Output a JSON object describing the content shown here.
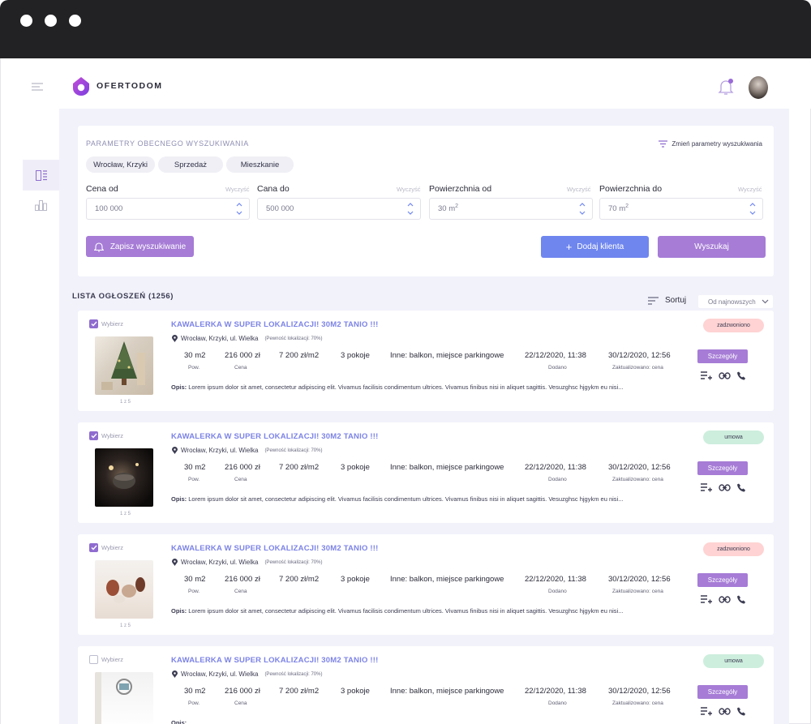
{
  "app": {
    "logo_text": "OFERTODOM"
  },
  "search_params": {
    "title": "PARAMETRY OBECNEGO WYSZUKIWANIA",
    "change_label": "Zmień parametry wyszukiwania",
    "chips": [
      "Wrocław, Krzyki",
      "Sprzedaż",
      "Mieszkanie"
    ],
    "fields": [
      {
        "label": "Cena od",
        "clear": "Wyczyść",
        "value": "100 000"
      },
      {
        "label": "Cana do",
        "clear": "Wyczyść",
        "value": "500 000"
      },
      {
        "label": "Powierzchnia od",
        "clear": "Wyczyść",
        "value": "30 m",
        "sup": "2"
      },
      {
        "label": "Powierzchnia do",
        "clear": "Wyczyść",
        "value": "70 m",
        "sup": "2"
      }
    ],
    "save_label": "Zapisz wyszukiwanie",
    "add_client_label": "Dodaj klienta",
    "search_label": "Wyszukaj"
  },
  "listing": {
    "title": "LISTA OGŁOSZEŃ (1256)",
    "sort_label": "Sortuj",
    "sort_value": "Od najnowszych",
    "select_label": "Wybierz",
    "labels": {
      "area": "Pow.",
      "price": "Cena",
      "added": "Dodano",
      "updated": "Zaktualizowano: cena",
      "desc_prefix": "Opis:",
      "details": "Szczegóły"
    },
    "items": [
      {
        "checked": true,
        "title": "KAWALERKA W SUPER LOKALIZACJI! 30M2 TANIO !!!",
        "location": "Wrocław, Krzyki, ul. Wielka",
        "confidence": "(Pewność lokalizacji: 70%)",
        "area": "30 m2",
        "price": "216 000 zł",
        "price_per_m": "7 200 zł/m2",
        "rooms": "3 pokoje",
        "other": "Inne: balkon, miejsce parkingowe",
        "added": "22/12/2020, 11:38",
        "updated": "30/12/2020, 12:56",
        "description": "Lorem ipsum dolor sit amet, consectetur adipiscing elit. Vivamus facilisis condimentum ultrices. Vivamus finibus nisi in aliquet sagittis. Vesuzghsc hjgykm eu nisi...",
        "photo_count": "1 z 5",
        "status": "zadzwoniono",
        "status_color": "#ffd3d3",
        "thumb": "tree"
      },
      {
        "checked": true,
        "title": "KAWALERKA W SUPER LOKALIZACJI! 30M2 TANIO !!!",
        "location": "Wrocław, Krzyki, ul. Wielka",
        "confidence": "(Pewność lokalizacji: 70%)",
        "area": "30 m2",
        "price": "216 000 zł",
        "price_per_m": "7 200 zł/m2",
        "rooms": "3 pokoje",
        "other": "Inne: balkon, miejsce parkingowe",
        "added": "22/12/2020, 11:38",
        "updated": "30/12/2020, 12:56",
        "description": "Lorem ipsum dolor sit amet, consectetur adipiscing elit. Vivamus facilisis condimentum ultrices. Vivamus finibus nisi in aliquet sagittis. Vesuzghsc hjgykm eu nisi...",
        "photo_count": "1 z 5",
        "status": "umowa",
        "status_color": "#cdeedd",
        "thumb": "dark"
      },
      {
        "checked": true,
        "title": "KAWALERKA W SUPER LOKALIZACJI! 30M2 TANIO !!!",
        "location": "Wrocław, Krzyki, ul. Wielka",
        "confidence": "(Pewność lokalizacji: 70%)",
        "area": "30 m2",
        "price": "216 000 zł",
        "price_per_m": "7 200 zł/m2",
        "rooms": "3 pokoje",
        "other": "Inne: balkon, miejsce parkingowe",
        "added": "22/12/2020, 11:38",
        "updated": "30/12/2020, 12:56",
        "description": "Lorem ipsum dolor sit amet, consectetur adipiscing elit. Vivamus facilisis condimentum ultrices. Vivamus finibus nisi in aliquet sagittis. Vesuzghsc hjgykm eu nisi...",
        "photo_count": "1 z 5",
        "status": "zadzwoniono",
        "status_color": "#ffd3d3",
        "thumb": "pots"
      },
      {
        "checked": false,
        "title": "KAWALERKA W SUPER LOKALIZACJI! 30M2 TANIO !!!",
        "location": "Wrocław, Krzyki, ul. Wielka",
        "confidence": "(Pewność lokalizacji: 70%)",
        "area": "30 m2",
        "price": "216 000 zł",
        "price_per_m": "7 200 zł/m2",
        "rooms": "3 pokoje",
        "other": "Inne: balkon, miejsce parkingowe",
        "added": "22/12/2020, 11:38",
        "updated": "30/12/2020, 12:56",
        "description": "",
        "photo_count": "",
        "status": "umowa",
        "status_color": "#cdeedd",
        "thumb": "light"
      }
    ]
  },
  "colors": {
    "accent": "#a67cd6",
    "blue": "#6f86ef",
    "bg": "#f1f2fa",
    "title": "#7c83e6"
  }
}
